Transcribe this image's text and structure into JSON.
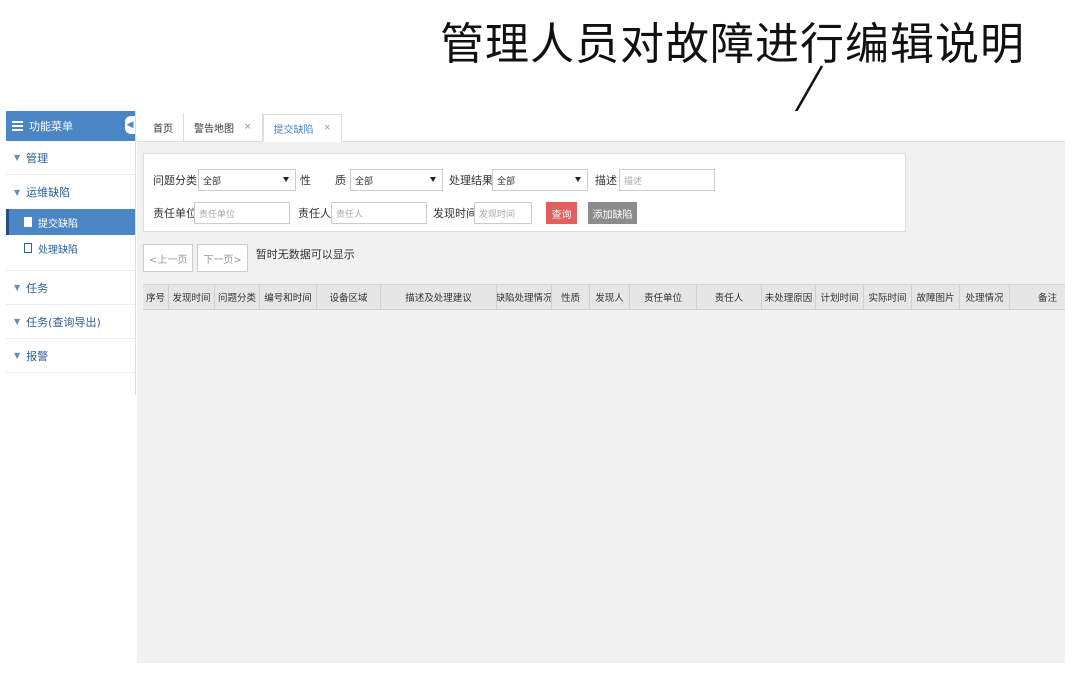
{
  "caption": "管理人员对故障进行编辑说明",
  "sidebar": {
    "header": "功能菜单",
    "groups": [
      "管理",
      "运维缺陷",
      "任务",
      "任务(查询导出)",
      "报警"
    ],
    "subitems": [
      "提交缺陷",
      "处理缺陷"
    ]
  },
  "tabs": [
    "首页",
    "警告地图",
    "提交缺陷"
  ],
  "filter": {
    "problem_type_label": "问题分类",
    "problem_type_value": "全部",
    "nature_label": "性",
    "nature_label2": "质",
    "nature_value": "全部",
    "result_label": "处理结果",
    "result_value": "全部",
    "desc_label": "描述",
    "desc_placeholder": "描述",
    "unit_label": "责任单位",
    "unit_placeholder": "责任单位",
    "person_label": "责任人",
    "person_placeholder": "责任人",
    "time_label": "发现时间",
    "time_placeholder": "发现时间",
    "query_button": "查询",
    "add_button": "添加缺陷"
  },
  "pager": {
    "prev": "<上一页",
    "next": "下一页>",
    "message": "暂时无数据可以显示"
  },
  "table": {
    "columns": [
      "序号",
      "发现时间",
      "问题分类",
      "编号和时间",
      "设备区域",
      "描述及处理建议",
      "缺陷处理情况",
      "性质",
      "发现人",
      "责任单位",
      "责任人",
      "未处理原因",
      "计划时间",
      "实际时间",
      "故障图片",
      "处理情况",
      "备注"
    ]
  },
  "colors": {
    "accent": "#4a86c5",
    "query": "#e06060",
    "add": "#8c8c8c"
  }
}
